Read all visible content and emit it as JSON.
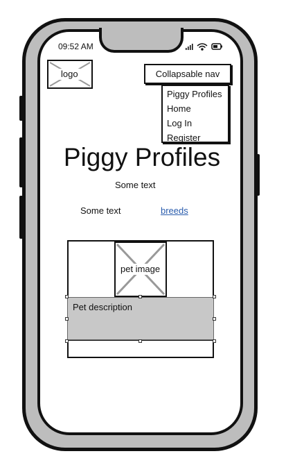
{
  "status_bar": {
    "time": "09:52 AM"
  },
  "header": {
    "logo_label": "logo",
    "nav_toggle_label": "Collapsable nav",
    "nav_items": [
      "Piggy Profiles",
      "Home",
      "Log In",
      "Register"
    ]
  },
  "main": {
    "title": "Piggy Profiles",
    "subtitle": "Some text",
    "row_text": "Some text",
    "breeds_link": "breeds"
  },
  "card": {
    "image_label": "pet image",
    "description": "Pet description"
  },
  "colors": {
    "phone_frame": "#bdbdbd",
    "outline": "#111111",
    "link": "#2a5cad",
    "description_fill": "#c8c8c8"
  }
}
